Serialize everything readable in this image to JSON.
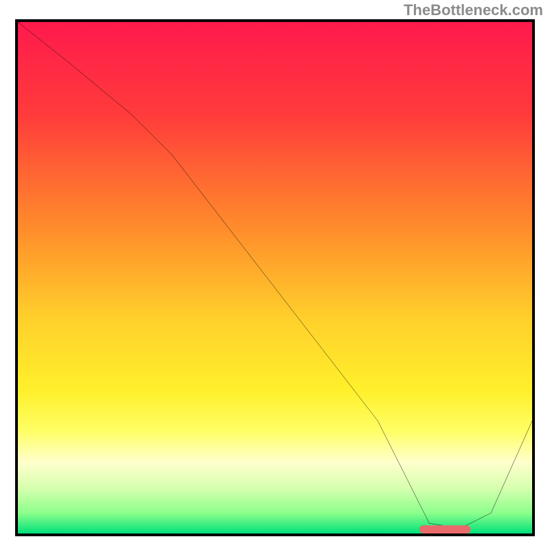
{
  "watermark": "TheBottleneck.com",
  "chart_data": {
    "type": "line",
    "title": "",
    "xlabel": "",
    "ylabel": "",
    "xlim": [
      0,
      100
    ],
    "ylim": [
      0,
      100
    ],
    "grid": false,
    "legend": false,
    "gradient_stops": [
      {
        "offset": 0,
        "color": "#ff1a4d"
      },
      {
        "offset": 18,
        "color": "#ff3b3b"
      },
      {
        "offset": 40,
        "color": "#ff8b2b"
      },
      {
        "offset": 58,
        "color": "#ffd02b"
      },
      {
        "offset": 72,
        "color": "#fff02b"
      },
      {
        "offset": 80,
        "color": "#ffff66"
      },
      {
        "offset": 86,
        "color": "#ffffcc"
      },
      {
        "offset": 91,
        "color": "#d8ffb0"
      },
      {
        "offset": 96,
        "color": "#8cff8c"
      },
      {
        "offset": 100,
        "color": "#00e07a"
      }
    ],
    "series": [
      {
        "name": "bottleneck-curve",
        "color": "#000000",
        "x": [
          0,
          10,
          22,
          30,
          40,
          50,
          60,
          70,
          76,
          80,
          86,
          92,
          100
        ],
        "y": [
          100,
          92,
          82,
          74,
          61,
          48,
          35,
          22,
          10,
          2,
          1,
          4,
          22
        ]
      }
    ],
    "marker": {
      "name": "optimal-range",
      "color": "#e96a6a",
      "x_start": 78,
      "x_end": 88,
      "y": 0.8,
      "height": 1.6
    }
  }
}
